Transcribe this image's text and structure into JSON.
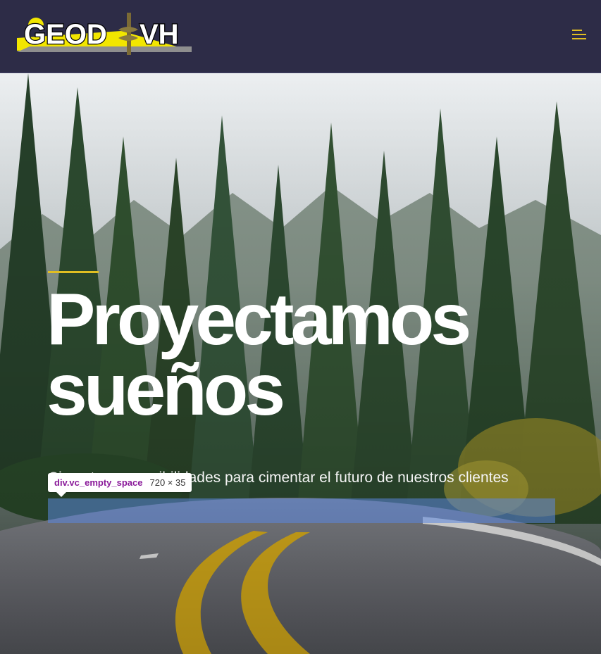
{
  "header": {
    "logo_text": "GEOD VH",
    "menu_icon": "hamburger-menu-icon"
  },
  "colors": {
    "header_bg": "#2d2c47",
    "accent": "#e1be22",
    "logo_yellow": "#f2e600",
    "overlay_highlight": "#5b86de"
  },
  "hero": {
    "title": "Proyectamos sueños",
    "subtitle": "Cimentamos posibilidades para cimentar el futuro de nuestros clientes"
  },
  "inspector": {
    "tag": "div.vc_empty_space",
    "dimensions": "720 × 35"
  }
}
